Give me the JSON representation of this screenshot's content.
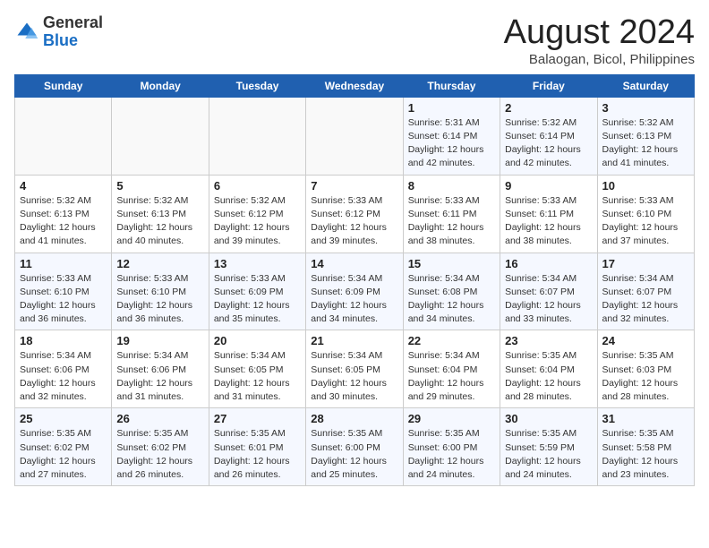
{
  "header": {
    "logo_general": "General",
    "logo_blue": "Blue",
    "title": "August 2024",
    "subtitle": "Balaogan, Bicol, Philippines"
  },
  "weekdays": [
    "Sunday",
    "Monday",
    "Tuesday",
    "Wednesday",
    "Thursday",
    "Friday",
    "Saturday"
  ],
  "weeks": [
    [
      {
        "day": "",
        "info": ""
      },
      {
        "day": "",
        "info": ""
      },
      {
        "day": "",
        "info": ""
      },
      {
        "day": "",
        "info": ""
      },
      {
        "day": "1",
        "info": "Sunrise: 5:31 AM\nSunset: 6:14 PM\nDaylight: 12 hours and 42 minutes."
      },
      {
        "day": "2",
        "info": "Sunrise: 5:32 AM\nSunset: 6:14 PM\nDaylight: 12 hours and 42 minutes."
      },
      {
        "day": "3",
        "info": "Sunrise: 5:32 AM\nSunset: 6:13 PM\nDaylight: 12 hours and 41 minutes."
      }
    ],
    [
      {
        "day": "4",
        "info": "Sunrise: 5:32 AM\nSunset: 6:13 PM\nDaylight: 12 hours and 41 minutes."
      },
      {
        "day": "5",
        "info": "Sunrise: 5:32 AM\nSunset: 6:13 PM\nDaylight: 12 hours and 40 minutes."
      },
      {
        "day": "6",
        "info": "Sunrise: 5:32 AM\nSunset: 6:12 PM\nDaylight: 12 hours and 39 minutes."
      },
      {
        "day": "7",
        "info": "Sunrise: 5:33 AM\nSunset: 6:12 PM\nDaylight: 12 hours and 39 minutes."
      },
      {
        "day": "8",
        "info": "Sunrise: 5:33 AM\nSunset: 6:11 PM\nDaylight: 12 hours and 38 minutes."
      },
      {
        "day": "9",
        "info": "Sunrise: 5:33 AM\nSunset: 6:11 PM\nDaylight: 12 hours and 38 minutes."
      },
      {
        "day": "10",
        "info": "Sunrise: 5:33 AM\nSunset: 6:10 PM\nDaylight: 12 hours and 37 minutes."
      }
    ],
    [
      {
        "day": "11",
        "info": "Sunrise: 5:33 AM\nSunset: 6:10 PM\nDaylight: 12 hours and 36 minutes."
      },
      {
        "day": "12",
        "info": "Sunrise: 5:33 AM\nSunset: 6:10 PM\nDaylight: 12 hours and 36 minutes."
      },
      {
        "day": "13",
        "info": "Sunrise: 5:33 AM\nSunset: 6:09 PM\nDaylight: 12 hours and 35 minutes."
      },
      {
        "day": "14",
        "info": "Sunrise: 5:34 AM\nSunset: 6:09 PM\nDaylight: 12 hours and 34 minutes."
      },
      {
        "day": "15",
        "info": "Sunrise: 5:34 AM\nSunset: 6:08 PM\nDaylight: 12 hours and 34 minutes."
      },
      {
        "day": "16",
        "info": "Sunrise: 5:34 AM\nSunset: 6:07 PM\nDaylight: 12 hours and 33 minutes."
      },
      {
        "day": "17",
        "info": "Sunrise: 5:34 AM\nSunset: 6:07 PM\nDaylight: 12 hours and 32 minutes."
      }
    ],
    [
      {
        "day": "18",
        "info": "Sunrise: 5:34 AM\nSunset: 6:06 PM\nDaylight: 12 hours and 32 minutes."
      },
      {
        "day": "19",
        "info": "Sunrise: 5:34 AM\nSunset: 6:06 PM\nDaylight: 12 hours and 31 minutes."
      },
      {
        "day": "20",
        "info": "Sunrise: 5:34 AM\nSunset: 6:05 PM\nDaylight: 12 hours and 31 minutes."
      },
      {
        "day": "21",
        "info": "Sunrise: 5:34 AM\nSunset: 6:05 PM\nDaylight: 12 hours and 30 minutes."
      },
      {
        "day": "22",
        "info": "Sunrise: 5:34 AM\nSunset: 6:04 PM\nDaylight: 12 hours and 29 minutes."
      },
      {
        "day": "23",
        "info": "Sunrise: 5:35 AM\nSunset: 6:04 PM\nDaylight: 12 hours and 28 minutes."
      },
      {
        "day": "24",
        "info": "Sunrise: 5:35 AM\nSunset: 6:03 PM\nDaylight: 12 hours and 28 minutes."
      }
    ],
    [
      {
        "day": "25",
        "info": "Sunrise: 5:35 AM\nSunset: 6:02 PM\nDaylight: 12 hours and 27 minutes."
      },
      {
        "day": "26",
        "info": "Sunrise: 5:35 AM\nSunset: 6:02 PM\nDaylight: 12 hours and 26 minutes."
      },
      {
        "day": "27",
        "info": "Sunrise: 5:35 AM\nSunset: 6:01 PM\nDaylight: 12 hours and 26 minutes."
      },
      {
        "day": "28",
        "info": "Sunrise: 5:35 AM\nSunset: 6:00 PM\nDaylight: 12 hours and 25 minutes."
      },
      {
        "day": "29",
        "info": "Sunrise: 5:35 AM\nSunset: 6:00 PM\nDaylight: 12 hours and 24 minutes."
      },
      {
        "day": "30",
        "info": "Sunrise: 5:35 AM\nSunset: 5:59 PM\nDaylight: 12 hours and 24 minutes."
      },
      {
        "day": "31",
        "info": "Sunrise: 5:35 AM\nSunset: 5:58 PM\nDaylight: 12 hours and 23 minutes."
      }
    ]
  ]
}
